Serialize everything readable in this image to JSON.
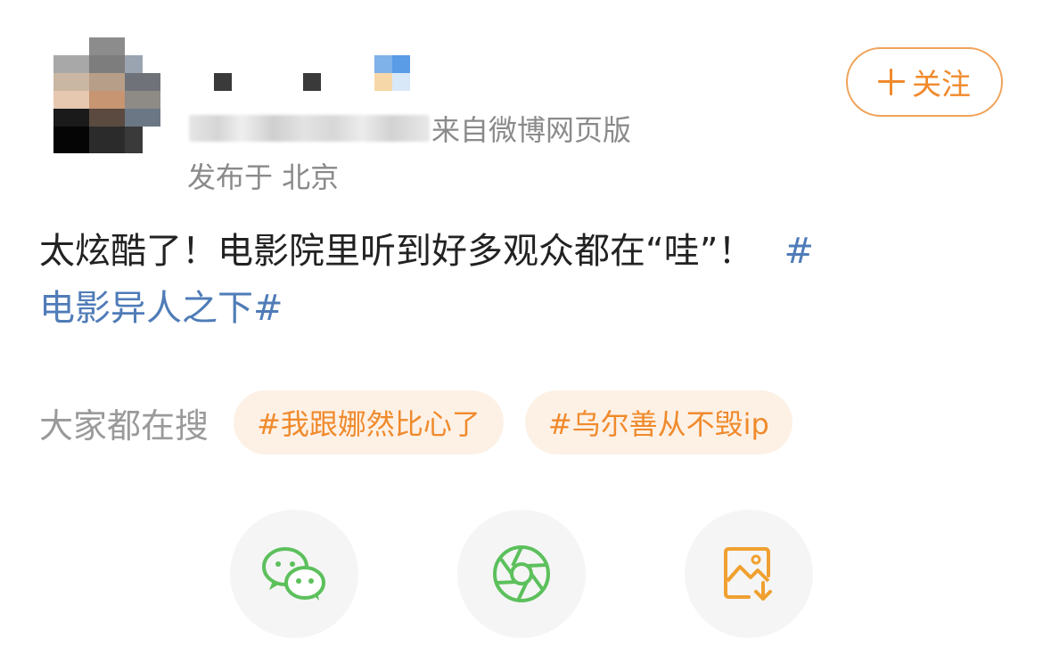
{
  "post": {
    "meta_source": "来自微博网页版",
    "location": "发布于 北京",
    "text_main": "太炫酷了！电影院里听到好多观众都在“哇”！",
    "hashtag_open": "#",
    "hashtag_rest": "电影异人之下#"
  },
  "follow_button": {
    "label": "关注"
  },
  "hot_search": {
    "label": "大家都在搜",
    "chips": [
      "#我跟娜然比心了",
      "#乌尔善从不毁ip"
    ]
  },
  "share": {
    "icons": [
      "wechat-icon",
      "moments-icon",
      "save-image-icon"
    ]
  },
  "colors": {
    "accent_orange": "#f08a2c",
    "link_blue": "#4f7cb8",
    "wechat_green": "#5cc05c",
    "chip_bg": "#fdf1e6"
  }
}
